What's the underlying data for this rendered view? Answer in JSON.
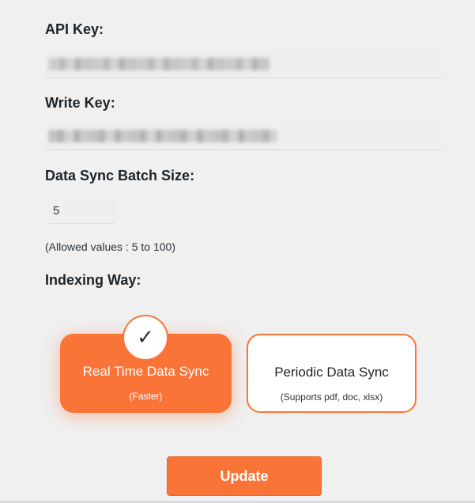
{
  "form": {
    "api_key_label": "API Key:",
    "write_key_label": "Write Key:",
    "batch_size_label": "Data Sync Batch Size:",
    "batch_size_value": "5",
    "batch_size_hint": "(Allowed values : 5 to 100)",
    "indexing_label": "Indexing Way:"
  },
  "indexing_options": [
    {
      "title": "Real Time Data Sync",
      "subtitle": "(Faster)",
      "selected": true
    },
    {
      "title": "Periodic Data Sync",
      "subtitle": "(Supports pdf, doc, xlsx)",
      "selected": false
    }
  ],
  "icons": {
    "selected_check": "check-icon",
    "selected_check_glyph": "✓"
  },
  "actions": {
    "update_label": "Update"
  },
  "colors": {
    "accent": "#fb7437",
    "background": "#f0f0f1",
    "field_background": "#efefef"
  }
}
